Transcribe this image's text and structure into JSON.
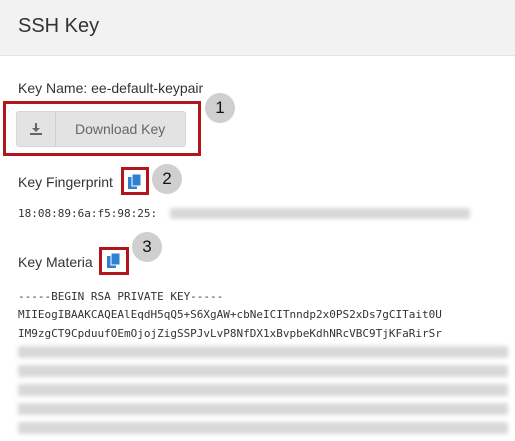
{
  "header": {
    "title": "SSH Key"
  },
  "key_name": {
    "label": "Key Name: ee-default-keypair"
  },
  "download": {
    "label": "Download Key"
  },
  "fingerprint": {
    "label": "Key Fingerprint",
    "value": "18:08:89:6a:f5:98:25:"
  },
  "material": {
    "label": "Key Materia",
    "line1": "-----BEGIN RSA PRIVATE KEY-----",
    "line2": "MIIEogIBAAKCAQEAlEqdH5qQ5+S6XgAW+cbNeICITnndp2x0PS2xDs7gCITait0U",
    "line3": "IM9zgCT9CpduufOEmOjojZigSSPJvLvP8NfDX1xBvpbeKdhNRcVBC9TjKFaRirSr"
  },
  "annotations": [
    "1",
    "2",
    "3"
  ],
  "colors": {
    "annotation_border": "#b2151b",
    "icon_blue": "#2f80d1"
  }
}
